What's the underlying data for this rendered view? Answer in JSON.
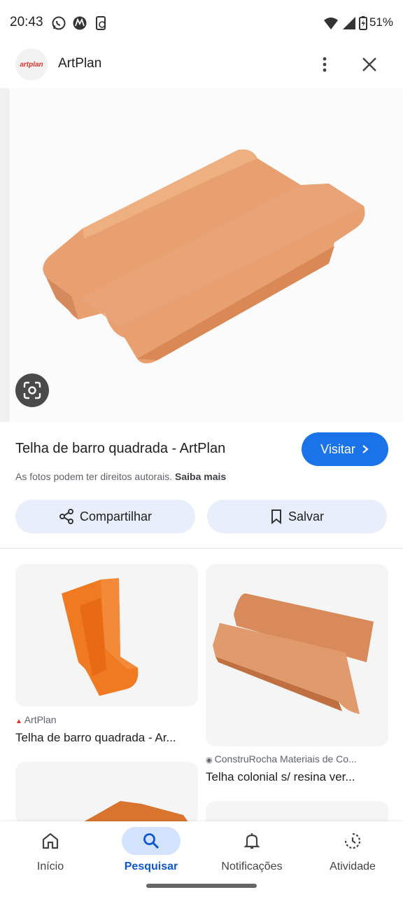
{
  "status_bar": {
    "time": "20:43",
    "battery": "51%"
  },
  "header": {
    "site_name": "ArtPlan",
    "logo_text": "artplan"
  },
  "result": {
    "title": "Telha de barro quadrada - ArtPlan",
    "visit_label": "Visitar",
    "copyright_text": "As fotos podem ter direitos autorais.",
    "learn_more": "Saiba mais",
    "share_label": "Compartilhar",
    "save_label": "Salvar"
  },
  "related": [
    {
      "source": "ArtPlan",
      "title": "Telha de barro quadrada - Ar..."
    },
    {
      "source": "ConstruRocha Materiais de Co...",
      "title": "Telha colonial s/ resina ver..."
    }
  ],
  "nav": [
    {
      "label": "Início",
      "icon": "home-icon"
    },
    {
      "label": "Pesquisar",
      "icon": "search-icon"
    },
    {
      "label": "Notificações",
      "icon": "bell-icon"
    },
    {
      "label": "Atividade",
      "icon": "activity-icon"
    }
  ],
  "colors": {
    "accent": "#1a73e8",
    "tile": "#e9a071",
    "tile_orange": "#f07a22"
  }
}
